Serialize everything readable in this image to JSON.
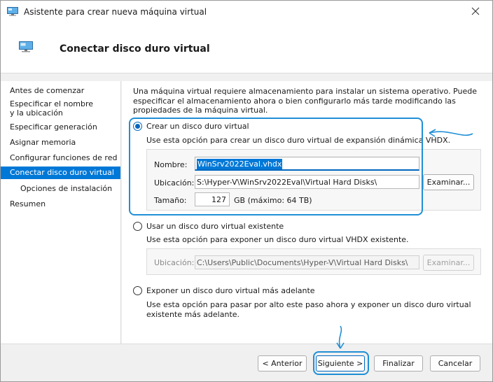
{
  "window": {
    "title": "Asistente para crear nueva máquina virtual",
    "header_title": "Conectar disco duro virtual"
  },
  "sidebar": {
    "items": [
      {
        "label": "Antes de comenzar"
      },
      {
        "label": "Especificar el nombre y la ubicación"
      },
      {
        "label": "Especificar generación"
      },
      {
        "label": "Asignar memoria"
      },
      {
        "label": "Configurar funciones de red"
      },
      {
        "label": "Conectar disco duro virtual"
      },
      {
        "label": "Opciones de instalación"
      },
      {
        "label": "Resumen"
      }
    ]
  },
  "main": {
    "intro": "Una máquina virtual requiere almacenamiento para instalar un sistema operativo. Puede especificar el almacenamiento ahora o bien configurarlo más tarde modificando las propiedades de la máquina virtual.",
    "option_create": {
      "label": "Crear un disco duro virtual",
      "description": "Use esta opción para crear un disco duro virtual de expansión dinámica VHDX.",
      "name_label": "Nombre:",
      "name_value": "WinSrv2022Eval.vhdx",
      "location_label": "Ubicación:",
      "location_value": "S:\\Hyper-V\\WinSrv2022Eval\\Virtual Hard Disks\\",
      "browse_label": "Examinar...",
      "size_label": "Tamaño:",
      "size_value": "127",
      "size_unit": "GB (máximo: 64 TB)"
    },
    "option_existing": {
      "label": "Usar un disco duro virtual existente",
      "description": "Use esta opción para exponer un disco duro virtual VHDX existente.",
      "location_label": "Ubicación:",
      "location_value": "C:\\Users\\Public\\Documents\\Hyper-V\\Virtual Hard Disks\\",
      "browse_label": "Examinar..."
    },
    "option_later": {
      "label": "Exponer un disco duro virtual más adelante",
      "description": "Use esta opción para pasar por alto este paso ahora y exponer un disco duro virtual existente más adelante."
    }
  },
  "footer": {
    "back_label": "< Anterior",
    "next_label": "Siguiente >",
    "finish_label": "Finalizar",
    "cancel_label": "Cancelar"
  },
  "colors": {
    "accent": "#0078d7",
    "annotation": "#1f8fd6"
  },
  "icons": {
    "title": "monitor-icon",
    "header": "monitor-icon",
    "close": "close-icon"
  }
}
